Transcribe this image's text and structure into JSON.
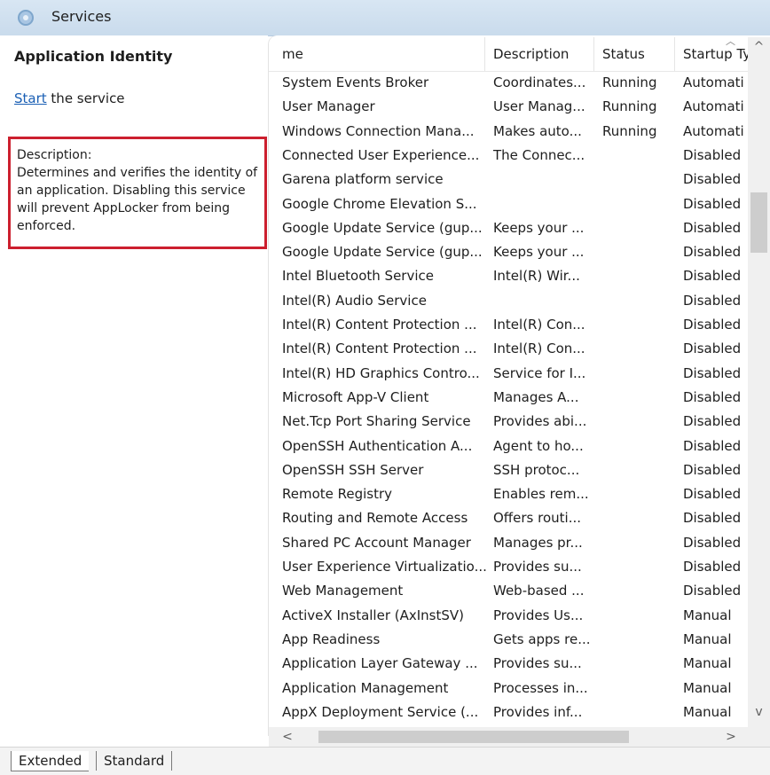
{
  "window": {
    "title": "Services",
    "icon": "services-gear-icon"
  },
  "selected_service": {
    "name": "Application Identity",
    "start_link": "Start",
    "start_suffix": " the service",
    "description_label": "Description:",
    "description_text": "Determines and verifies the identity of an application. Disabling this service will prevent AppLocker from being enforced."
  },
  "columns": {
    "name": "me",
    "description": "Description",
    "status": "Status",
    "startup": "Startup Ty"
  },
  "services": [
    {
      "name": "System Events Broker",
      "description": "Coordinates...",
      "status": "Running",
      "startup": "Automati"
    },
    {
      "name": "User Manager",
      "description": "User Manag...",
      "status": "Running",
      "startup": "Automati"
    },
    {
      "name": "Windows Connection Mana...",
      "description": "Makes auto...",
      "status": "Running",
      "startup": "Automati"
    },
    {
      "name": "Connected User Experience...",
      "description": "The Connec...",
      "status": "",
      "startup": "Disabled"
    },
    {
      "name": "Garena platform service",
      "description": "",
      "status": "",
      "startup": "Disabled"
    },
    {
      "name": "Google Chrome Elevation S...",
      "description": "",
      "status": "",
      "startup": "Disabled"
    },
    {
      "name": "Google Update Service (gup...",
      "description": "Keeps your ...",
      "status": "",
      "startup": "Disabled"
    },
    {
      "name": "Google Update Service (gup...",
      "description": "Keeps your ...",
      "status": "",
      "startup": "Disabled"
    },
    {
      "name": "Intel Bluetooth Service",
      "description": "Intel(R) Wir...",
      "status": "",
      "startup": "Disabled"
    },
    {
      "name": "Intel(R) Audio Service",
      "description": "",
      "status": "",
      "startup": "Disabled"
    },
    {
      "name": "Intel(R) Content Protection ...",
      "description": "Intel(R) Con...",
      "status": "",
      "startup": "Disabled"
    },
    {
      "name": "Intel(R) Content Protection ...",
      "description": "Intel(R) Con...",
      "status": "",
      "startup": "Disabled"
    },
    {
      "name": "Intel(R) HD Graphics Contro...",
      "description": "Service for I...",
      "status": "",
      "startup": "Disabled"
    },
    {
      "name": "Microsoft App-V Client",
      "description": "Manages A...",
      "status": "",
      "startup": "Disabled"
    },
    {
      "name": "Net.Tcp Port Sharing Service",
      "description": "Provides abi...",
      "status": "",
      "startup": "Disabled"
    },
    {
      "name": "OpenSSH Authentication A...",
      "description": "Agent to ho...",
      "status": "",
      "startup": "Disabled"
    },
    {
      "name": "OpenSSH SSH Server",
      "description": "SSH protoc...",
      "status": "",
      "startup": "Disabled"
    },
    {
      "name": "Remote Registry",
      "description": "Enables rem...",
      "status": "",
      "startup": "Disabled"
    },
    {
      "name": "Routing and Remote Access",
      "description": "Offers routi...",
      "status": "",
      "startup": "Disabled"
    },
    {
      "name": "Shared PC Account Manager",
      "description": "Manages pr...",
      "status": "",
      "startup": "Disabled"
    },
    {
      "name": "User Experience Virtualizatio...",
      "description": "Provides su...",
      "status": "",
      "startup": "Disabled"
    },
    {
      "name": "Web Management",
      "description": "Web-based ...",
      "status": "",
      "startup": "Disabled"
    },
    {
      "name": "ActiveX Installer (AxInstSV)",
      "description": "Provides Us...",
      "status": "",
      "startup": "Manual"
    },
    {
      "name": "App Readiness",
      "description": "Gets apps re...",
      "status": "",
      "startup": "Manual"
    },
    {
      "name": "Application Layer Gateway ...",
      "description": "Provides su...",
      "status": "",
      "startup": "Manual"
    },
    {
      "name": "Application Management",
      "description": "Processes in...",
      "status": "",
      "startup": "Manual"
    },
    {
      "name": "AppX Deployment Service (...",
      "description": "Provides inf...",
      "status": "",
      "startup": "Manual"
    }
  ],
  "scrollbars": {
    "up": "^",
    "down": "v",
    "left": "<",
    "right": ">"
  },
  "tabs": {
    "extended": "Extended",
    "standard": "Standard"
  },
  "colors": {
    "highlight_border": "#cc1f2e",
    "link": "#1a5fb4",
    "titlebar": "#c9dbec"
  }
}
